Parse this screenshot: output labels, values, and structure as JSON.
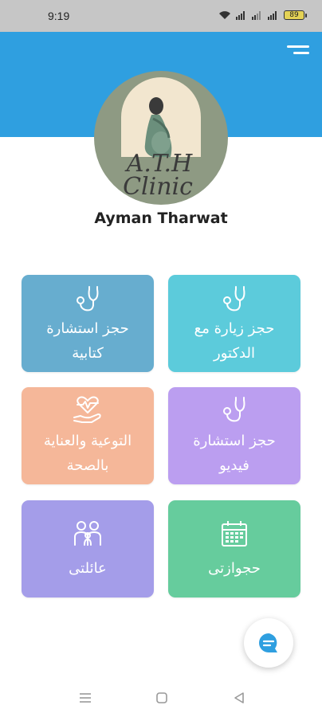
{
  "status_bar": {
    "time": "9:19",
    "battery_level": "89"
  },
  "header": {
    "menu_icon": "hamburger-menu-icon",
    "background_color": "#2f9fe0"
  },
  "profile": {
    "logo_text_1": "A.T.H",
    "logo_text_2": "Clinic",
    "name": "Ayman Tharwat"
  },
  "cards": [
    {
      "line1": "حجز زيارة مع",
      "line2": "الدكتور",
      "icon": "stethoscope-icon",
      "color": "#5ccbdb"
    },
    {
      "line1": "حجز استشارة",
      "line2": "كتابية",
      "icon": "stethoscope-icon",
      "color": "#67adcf"
    },
    {
      "line1": "حجز استشارة",
      "line2": "فيديو",
      "icon": "stethoscope-icon",
      "color": "#bb9ef0"
    },
    {
      "line1": "التوعية والعناية",
      "line2": "بالصحة",
      "icon": "heart-care-icon",
      "color": "#f5b799"
    },
    {
      "line1": "حجوازتى",
      "line2": "",
      "icon": "calendar-icon",
      "color": "#66cc9d"
    },
    {
      "line1": "عائلتى",
      "line2": "",
      "icon": "family-icon",
      "color": "#a49de9"
    }
  ],
  "fab": {
    "icon": "chat-icon",
    "color": "#2f9fe0"
  },
  "nav_bar": {
    "icons": [
      "recent-apps-icon",
      "home-icon",
      "back-icon"
    ]
  }
}
